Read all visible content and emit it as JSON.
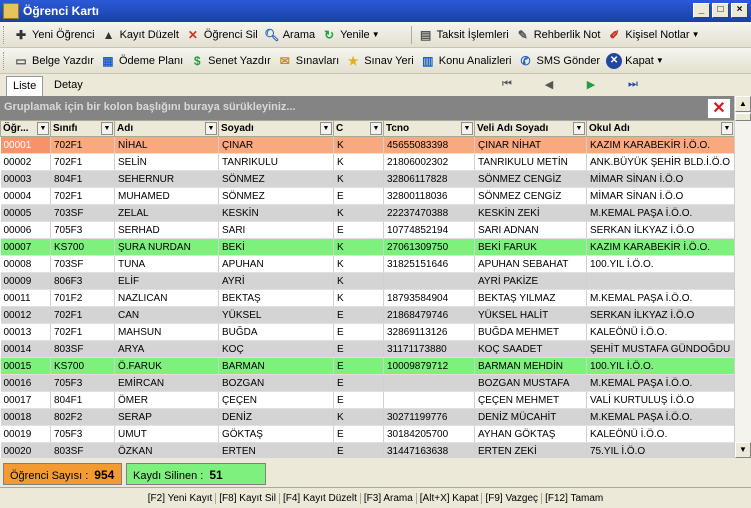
{
  "window": {
    "title": "Öğrenci Kartı"
  },
  "toolbar1": {
    "items": [
      {
        "label": "Yeni Öğrenci",
        "icon": "plus-icon"
      },
      {
        "label": "Kayıt Düzelt",
        "icon": "arrow-up-icon"
      },
      {
        "label": "Öğrenci Sil",
        "icon": "delete-x-icon"
      },
      {
        "label": "Arama",
        "icon": "search-icon"
      },
      {
        "label": "Yenile",
        "icon": "refresh-icon"
      },
      {
        "label": "Taksit İşlemleri",
        "icon": "installments-icon"
      },
      {
        "label": "Rehberlik Not",
        "icon": "guidance-note-icon"
      },
      {
        "label": "Kişisel Notlar",
        "icon": "personal-notes-icon"
      }
    ]
  },
  "toolbar2": {
    "items": [
      {
        "label": "Belge Yazdır",
        "icon": "print-icon"
      },
      {
        "label": "Ödeme Planı",
        "icon": "payment-plan-icon"
      },
      {
        "label": "Senet Yazdır",
        "icon": "promissory-icon"
      },
      {
        "label": "Sınavları",
        "icon": "exams-icon"
      },
      {
        "label": "Sınav Yeri",
        "icon": "star-icon"
      },
      {
        "label": "Konu Analizleri",
        "icon": "analysis-icon"
      },
      {
        "label": "SMS Gönder",
        "icon": "sms-icon"
      },
      {
        "label": "Kapat",
        "icon": "close-icon"
      }
    ]
  },
  "tabs": [
    {
      "label": "Liste"
    },
    {
      "label": "Detay"
    }
  ],
  "group_hint": "Gruplamak için bir kolon başlığını buraya sürükleyiniz...",
  "columns": [
    "Öğr...",
    "Sınıfı",
    "Adı",
    "Soyadı",
    "C",
    "Tcno",
    "Veli Adı Soyadı",
    "Okul Adı"
  ],
  "rows": [
    {
      "id": "00001",
      "sinif": "702F1",
      "ad": "NİHAL",
      "soyad": "ÇINAR",
      "c": "K",
      "tc": "45655083398",
      "veli": "ÇINAR NİHAT",
      "okul": "KAZIM KARABEKİR İ.Ö.O.",
      "state": "selected"
    },
    {
      "id": "00002",
      "sinif": "702F1",
      "ad": "SELİN",
      "soyad": "TANRIKULU",
      "c": "K",
      "tc": "21806002302",
      "veli": "TANRIKULU METİN",
      "okul": "ANK.BÜYÜK ŞEHİR BLD.İ.Ö.O",
      "state": "even"
    },
    {
      "id": "00003",
      "sinif": "804F1",
      "ad": "SEHERNUR",
      "soyad": "SÖNMEZ",
      "c": "K",
      "tc": "32806117828",
      "veli": "SÖNMEZ CENGİZ",
      "okul": "MİMAR SİNAN İ.Ö.O",
      "state": "odd"
    },
    {
      "id": "00004",
      "sinif": "702F1",
      "ad": "MUHAMED",
      "soyad": "SÖNMEZ",
      "c": "E",
      "tc": "32800118036",
      "veli": "SÖNMEZ CENGİZ",
      "okul": "MİMAR SİNAN İ.Ö.O",
      "state": "even"
    },
    {
      "id": "00005",
      "sinif": "703SF",
      "ad": "ZELAL",
      "soyad": "KESKİN",
      "c": "K",
      "tc": "22237470388",
      "veli": "KESKİN ZEKİ",
      "okul": "M.KEMAL PAŞA İ.Ö.O.",
      "state": "odd"
    },
    {
      "id": "00006",
      "sinif": "705F3",
      "ad": "SERHAD",
      "soyad": "SARI",
      "c": "E",
      "tc": "10774852194",
      "veli": "SARI ADNAN",
      "okul": "SERKAN İLKYAZ İ.Ö.O",
      "state": "even"
    },
    {
      "id": "00007",
      "sinif": "KS700",
      "ad": "ŞURA NURDAN",
      "soyad": "BEKİ",
      "c": "K",
      "tc": "27061309750",
      "veli": "BEKİ FARUK",
      "okul": "KAZIM KARABEKİR İ.Ö.O.",
      "state": "green"
    },
    {
      "id": "00008",
      "sinif": "703SF",
      "ad": "TUNA",
      "soyad": "APUHAN",
      "c": "K",
      "tc": "31825151646",
      "veli": "APUHAN SEBAHAT",
      "okul": "100.YIL İ.Ö.O.",
      "state": "even"
    },
    {
      "id": "00009",
      "sinif": "806F3",
      "ad": "ELİF",
      "soyad": "AYRİ",
      "c": "K",
      "tc": "",
      "veli": "AYRİ PAKİZE",
      "okul": "",
      "state": "odd"
    },
    {
      "id": "00011",
      "sinif": "701F2",
      "ad": "NAZLICAN",
      "soyad": "BEKTAŞ",
      "c": "K",
      "tc": "18793584904",
      "veli": "BEKTAŞ YILMAZ",
      "okul": "M.KEMAL PAŞA İ.Ö.O.",
      "state": "even"
    },
    {
      "id": "00012",
      "sinif": "702F1",
      "ad": "CAN",
      "soyad": "YÜKSEL",
      "c": "E",
      "tc": "21868479746",
      "veli": "YÜKSEL HALİT",
      "okul": "SERKAN İLKYAZ İ.Ö.O",
      "state": "odd"
    },
    {
      "id": "00013",
      "sinif": "702F1",
      "ad": "MAHSUN",
      "soyad": "BUĞDA",
      "c": "E",
      "tc": "32869113126",
      "veli": "BUĞDA MEHMET",
      "okul": "KALEÖNÜ İ.Ö.O.",
      "state": "even"
    },
    {
      "id": "00014",
      "sinif": "803SF",
      "ad": "ARYA",
      "soyad": "KOÇ",
      "c": "E",
      "tc": "31171173880",
      "veli": "KOÇ SAADET",
      "okul": "ŞEHİT MUSTAFA GÜNDOĞDU",
      "state": "odd"
    },
    {
      "id": "00015",
      "sinif": "KS700",
      "ad": "Ö.FARUK",
      "soyad": "BARMAN",
      "c": "E",
      "tc": "10009879712",
      "veli": "BARMAN MEHDİN",
      "okul": "100.YIL İ.Ö.O.",
      "state": "green"
    },
    {
      "id": "00016",
      "sinif": "705F3",
      "ad": "EMİRCAN",
      "soyad": "BOZGAN",
      "c": "E",
      "tc": "",
      "veli": "BOZGAN MUSTAFA",
      "okul": "M.KEMAL PAŞA İ.Ö.O.",
      "state": "odd"
    },
    {
      "id": "00017",
      "sinif": "804F1",
      "ad": "ÖMER",
      "soyad": "ÇEÇEN",
      "c": "E",
      "tc": "",
      "veli": "ÇEÇEN MEHMET",
      "okul": "VALİ KURTULUŞ İ.Ö.O",
      "state": "even"
    },
    {
      "id": "00018",
      "sinif": "802F2",
      "ad": "SERAP",
      "soyad": "DENİZ",
      "c": "K",
      "tc": "30271199776",
      "veli": "DENİZ MÜCAHİT",
      "okul": "M.KEMAL PAŞA İ.Ö.O.",
      "state": "odd"
    },
    {
      "id": "00019",
      "sinif": "705F3",
      "ad": "UMUT",
      "soyad": "GÖKTAŞ",
      "c": "E",
      "tc": "30184205700",
      "veli": "AYHAN GÖKTAŞ",
      "okul": "KALEÖNÜ İ.Ö.O.",
      "state": "even"
    },
    {
      "id": "00020",
      "sinif": "803SF",
      "ad": "ÖZKAN",
      "soyad": "ERTEN",
      "c": "E",
      "tc": "31447163638",
      "veli": "ERTEN ZEKİ",
      "okul": "75.YIL İ.Ö.O",
      "state": "odd"
    }
  ],
  "status": {
    "count_label": "Öğrenci Sayısı :",
    "count_value": "954",
    "deleted_label": "Kaydı Silinen :",
    "deleted_value": "51"
  },
  "shortcuts": [
    "[F2] Yeni Kayıt",
    "[F8] Kayıt Sil",
    "[F4] Kayıt Düzelt",
    "[F3] Arama",
    "[Alt+X] Kapat",
    "[F9] Vazgeç",
    "[F12] Tamam"
  ],
  "colors": {
    "selected": "#f5936a",
    "highlight": "#7ef07e",
    "count_badge": "#f39b32",
    "title": "#1941a5"
  }
}
